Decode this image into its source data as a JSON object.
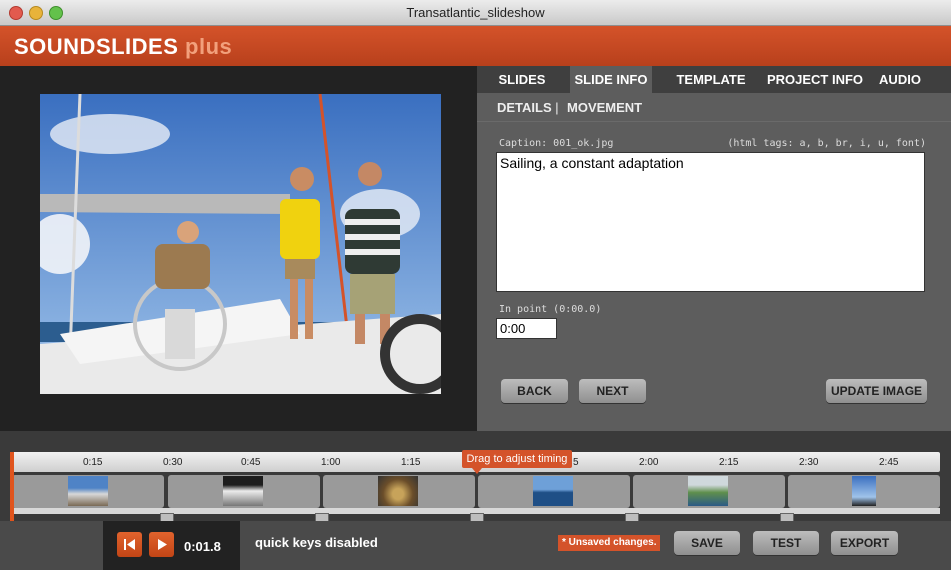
{
  "window": {
    "title": "Transatlantic_slideshow"
  },
  "app": {
    "brand_main": "SOUNDSLIDES",
    "brand_plus": "plus",
    "accent": "#d4532a"
  },
  "tabs": [
    {
      "label": "SLIDES",
      "active": false
    },
    {
      "label": "SLIDE INFO",
      "active": true
    },
    {
      "label": "TEMPLATE",
      "active": false
    },
    {
      "label": "PROJECT INFO",
      "active": false
    },
    {
      "label": "AUDIO",
      "active": false
    }
  ],
  "subtabs": [
    {
      "label": "DETAILS",
      "active": true
    },
    {
      "label": "MOVEMENT",
      "active": false
    }
  ],
  "subtab_separator": "|",
  "details": {
    "caption_label": "Caption: 001_ok.jpg",
    "html_tags_hint": "(html tags: a, b, br, i, u, font)",
    "caption_value": "Sailing, a constant adaptation",
    "in_point_label": "In point (0:00.0)",
    "in_point_value": "0:00",
    "back_label": "BACK",
    "next_label": "NEXT",
    "update_label": "UPDATE IMAGE"
  },
  "timeline": {
    "ticks": [
      "0:15",
      "0:30",
      "0:45",
      "1:00",
      "1:15",
      "5",
      "2:00",
      "2:15",
      "2:30",
      "2:45"
    ],
    "tooltip": "Drag to adjust timing",
    "slots": [
      "deck",
      "boat",
      "group",
      "sea",
      "island",
      "mast"
    ]
  },
  "player": {
    "timecode": "0:01.8",
    "quick_keys": "quick keys disabled"
  },
  "status": {
    "unsaved": "* Unsaved changes."
  },
  "actions": {
    "save": "SAVE",
    "test": "TEST",
    "export": "EXPORT"
  }
}
